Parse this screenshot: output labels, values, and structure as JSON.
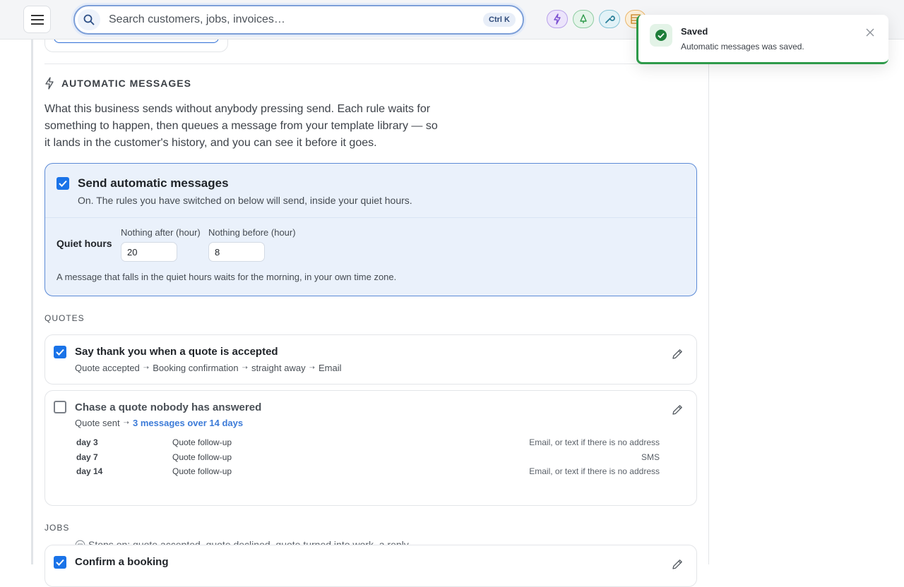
{
  "topbar": {
    "search_placeholder": "Search customers, jobs, invoices…",
    "shortcut": "Ctrl K",
    "icons": [
      "menu-icon",
      "search-icon",
      "lightning-icon",
      "bell-icon",
      "wrench-icon",
      "grid-icon"
    ]
  },
  "section": {
    "title": "AUTOMATIC MESSAGES",
    "intro": "What this business sends without anybody pressing send. Each rule waits for something to happen, then queues a message from your template library — so it lands in the customer's history, and you can see it before it goes."
  },
  "master": {
    "checked": true,
    "title": "Send automatic messages",
    "subtitle": "On. The rules you have switched on below will send, inside your quiet hours.",
    "quiet_label": "Quiet hours",
    "after_label": "Nothing after (hour)",
    "after_value": "20",
    "before_label": "Nothing before (hour)",
    "before_value": "8",
    "note": "A message that falls in the quiet hours waits for the morning, in your own time zone."
  },
  "groups": {
    "quotes": "QUOTES",
    "jobs": "JOBS"
  },
  "rules": [
    {
      "checked": true,
      "title": "Say thank you when a quote is accepted",
      "trigger": "Quote accepted",
      "template": "Booking confirmation",
      "timing": "straight away",
      "channel": "Email"
    },
    {
      "checked": false,
      "title": "Chase a quote nobody has answered",
      "trigger": "Quote sent",
      "schedule": "3 messages over 14 days",
      "steps": [
        {
          "day": "day 3",
          "template": "Quote follow-up",
          "channel": "Email, or text if there is no address"
        },
        {
          "day": "day 7",
          "template": "Quote follow-up",
          "channel": "SMS"
        },
        {
          "day": "day 14",
          "template": "Quote follow-up",
          "channel": "Email, or text if there is no address"
        }
      ],
      "stops": "Stops on: quote accepted, quote declined, quote turned into work, a reply"
    },
    {
      "checked": true,
      "title": "Confirm a booking"
    }
  ],
  "toast": {
    "title": "Saved",
    "message": "Automatic messages was saved."
  },
  "colors": {
    "accent": "#1a73e8",
    "success": "#2e9a4a",
    "link": "#3c7bd8"
  }
}
